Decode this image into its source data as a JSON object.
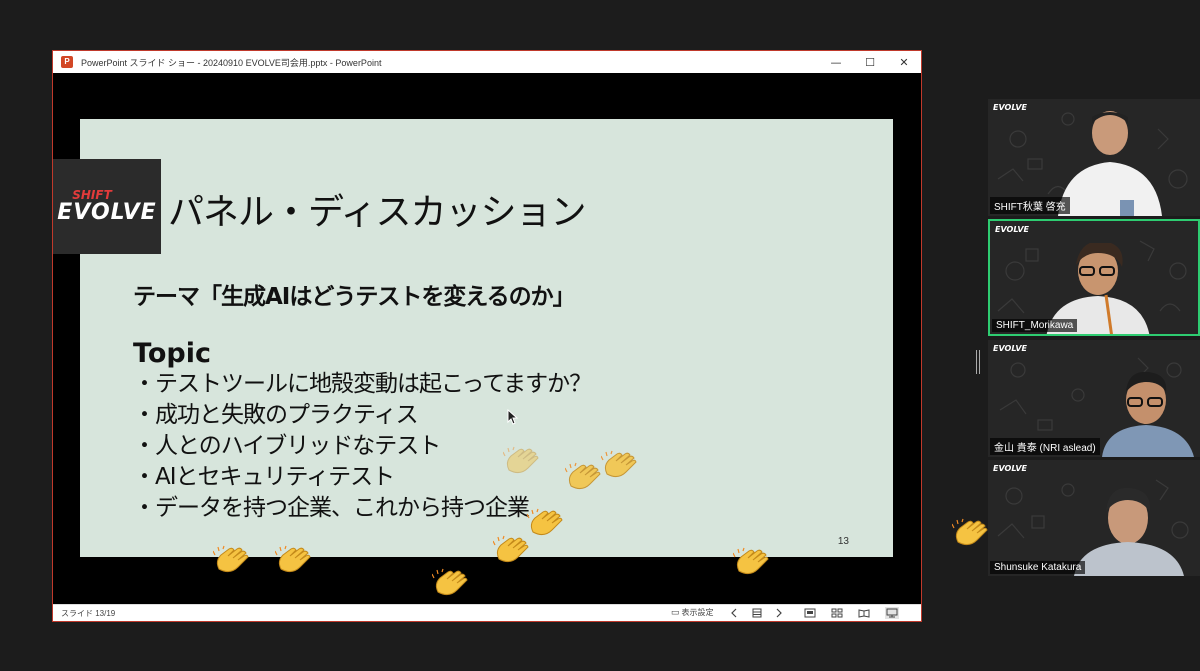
{
  "window": {
    "title": "PowerPoint スライド ショー  -  20240910 EVOLVE司会用.pptx - PowerPoint",
    "app_icon": "P",
    "controls": {
      "minimize": "—",
      "maximize": "☐",
      "close": "✕"
    }
  },
  "slide": {
    "logo_top": "SHIFT",
    "logo_main": "EVOLVE",
    "title": "パネル・ディスカッション",
    "theme": "テーマ「生成AIはどうテストを変えるのか」",
    "topic_heading": "Topic",
    "topics": [
      "・テストツールに地殻変動は起こってますか？",
      "・成功と失敗のプラクティス",
      "・人とのハイブリッドなテスト",
      "・AIとセキュリティテスト",
      "・データを持つ企業、これから持つ企業"
    ],
    "number": "13",
    "background_color": "#d7e5dc"
  },
  "statusbar": {
    "slide_count": "スライド 13/19",
    "display_settings": "表示設定"
  },
  "participants": [
    {
      "name": "SHIFT秋葉 啓充",
      "logo": "EVOLVE"
    },
    {
      "name": "SHIFT_Morikawa",
      "logo": "EVOLVE",
      "active": true
    },
    {
      "name": "金山 貴泰 (NRI aslead)",
      "logo": "EVOLVE"
    },
    {
      "name": "Shunsuke Katakura",
      "logo": "EVOLVE"
    }
  ],
  "colors": {
    "active_speaker_border": "#2ecc71",
    "window_border": "#c0392b",
    "clap_emoji": "#f5c342"
  },
  "icons": {
    "clap": "clapping-hands-icon",
    "cursor": "mouse-pointer-icon"
  }
}
